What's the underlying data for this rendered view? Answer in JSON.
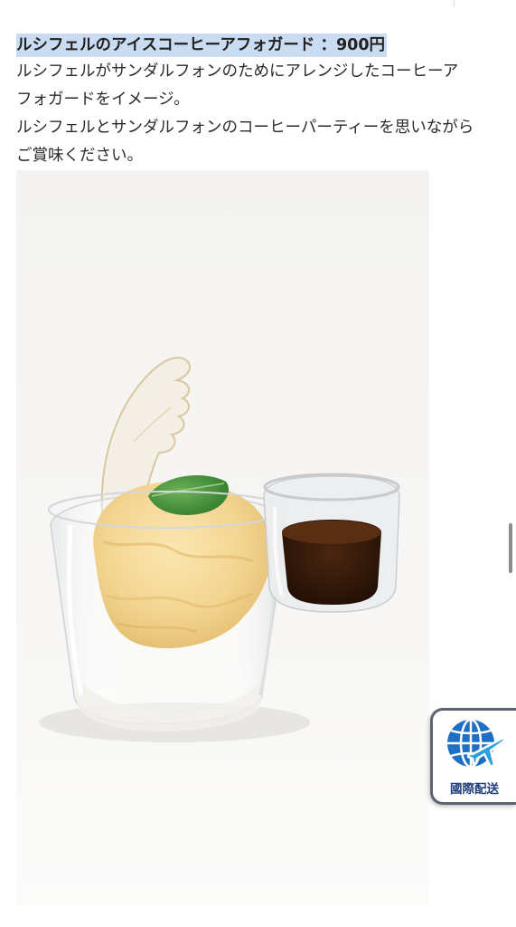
{
  "menu_item": {
    "title": "ルシフェルのアイスコーヒーアフォガード ：900円",
    "description_lines": [
      "ルシフェルがサンダルフォンのためにアレンジしたコーヒーア",
      "フォガードをイメージ。",
      "ルシフェルとサンダルフォンのコーヒーパーティーを思いながら",
      "ご賞味ください。"
    ]
  },
  "intl_shipping": {
    "label": "國際配送",
    "icon": "globe-airplane-icon",
    "colors": {
      "globe": "#1f6fc4",
      "plane": "#2aa0dc",
      "text": "#1f3e7a"
    }
  }
}
